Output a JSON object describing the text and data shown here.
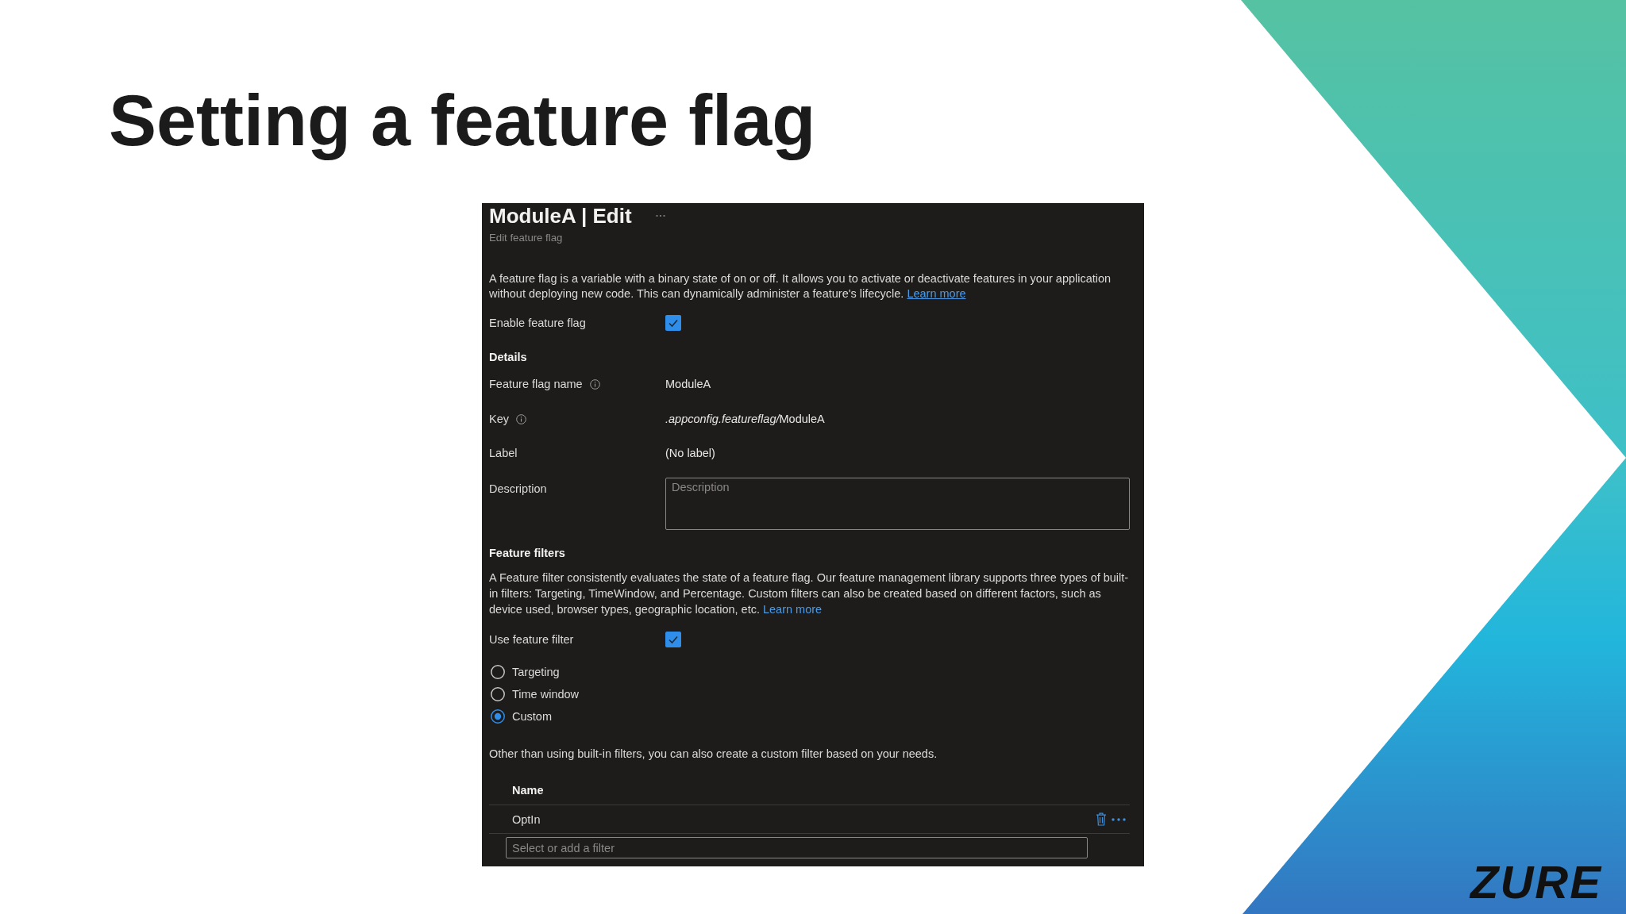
{
  "slide": {
    "title": "Setting a feature flag",
    "logo": "ZURE"
  },
  "panel": {
    "title": "ModuleA | Edit",
    "subtitle": "Edit feature flag",
    "intro": {
      "text": "A feature flag is a variable with a binary state of on or off. It allows you to activate or deactivate features in your application without deploying new code. This can dynamically administer a feature's lifecycle.",
      "link": "Learn more"
    },
    "enable": {
      "label": "Enable feature flag",
      "checked": true
    },
    "details": {
      "heading": "Details",
      "fields": [
        {
          "label": "Feature flag name",
          "info": true,
          "value": [
            {
              "text": "ModuleA",
              "italic": false
            }
          ]
        },
        {
          "label": "Key",
          "info": true,
          "value": [
            {
              "text": ".appconfig.featureflag/",
              "italic": true
            },
            {
              "text": "ModuleA",
              "italic": false
            }
          ]
        },
        {
          "label": "Label",
          "info": false,
          "value": [
            {
              "text": "(No label)",
              "italic": false
            }
          ]
        }
      ],
      "description": {
        "label": "Description",
        "placeholder": "Description"
      }
    },
    "filters": {
      "heading": "Feature filters",
      "text": "A Feature filter consistently evaluates the state of a feature flag. Our feature management library supports three types of built-in filters: Targeting, TimeWindow, and Percentage. Custom filters can also be created based on different factors, such as device used, browser types, geographic location, etc.",
      "link": "Learn more",
      "use_filter": {
        "label": "Use feature filter",
        "checked": true
      },
      "options": [
        {
          "label": "Targeting",
          "selected": false
        },
        {
          "label": "Time window",
          "selected": false
        },
        {
          "label": "Custom",
          "selected": true
        }
      ],
      "note": "Other than using built-in filters, you can also create a custom filter based on your needs.",
      "table": {
        "columns": [
          "Name"
        ],
        "rows": [
          [
            "OptIn"
          ]
        ]
      },
      "select": {
        "placeholder": "Select or add a filter"
      }
    }
  }
}
